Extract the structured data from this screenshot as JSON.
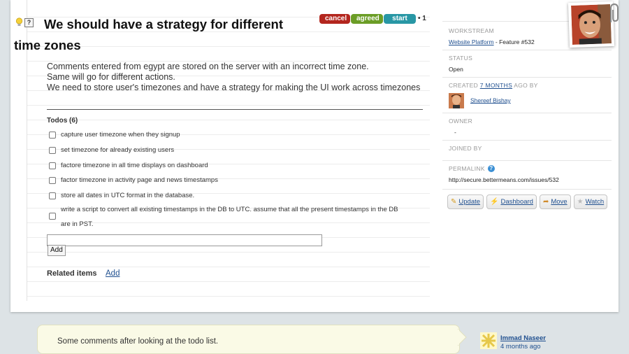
{
  "issue": {
    "title": "We should have a strategy for different time zones",
    "status_buttons": {
      "cancel": "cancel",
      "agreed": "agreed",
      "start": "start"
    },
    "vote_count": "• 1",
    "description": [
      "Comments entered from egypt are stored on the server with an incorrect time zone.",
      "Same will go for different actions.",
      "We need to store user's timezones and have a strategy for making the UI work across timezones"
    ]
  },
  "todos": {
    "header": "Todos (6)",
    "items": [
      "capture user timezone when they signup",
      "set timezone for already existing users",
      "factore timezone in all time displays on dashboard",
      "factor timezone in activity page and news timestamps",
      "store all dates in UTC format in the database.",
      "write a script to convert all existing timestamps in the DB to UTC. assume that all the present timestamps in the DB are in PST."
    ],
    "add_label": "Add",
    "input_value": ""
  },
  "related": {
    "label": "Related items",
    "add_label": "Add"
  },
  "sidebar": {
    "workstream_label": "WORKSTREAM",
    "workstream_link": "Website Platform",
    "workstream_suffix": " - Feature #532",
    "status_label": "STATUS",
    "status_value": "Open",
    "created_prefix": "CREATED ",
    "created_link": "7 MONTHS",
    "created_suffix": " AGO BY",
    "creator_name": "Shereef Bishay",
    "owner_label": "OWNER",
    "owner_value": "-",
    "joined_label": "JOINED BY",
    "permalink_label": "PERMALINK",
    "permalink_value": "http://secure.bettermeans.com/issues/532"
  },
  "actions": {
    "update": "Update",
    "dashboard": "Dashboard",
    "move": "Move",
    "watch": "Watch"
  },
  "comment": {
    "text": "Some comments after looking at the todo list.",
    "author": "Immad Naseer",
    "time": "4 months ago"
  },
  "icons": [
    "bulb-icon",
    "help-icon",
    "pencil-icon",
    "bolt-icon",
    "arrow-icon",
    "star-icon"
  ],
  "colors": {
    "cancel": "#b3261e",
    "agreed": "#6b9d26",
    "start": "#2897a5",
    "link": "#1f4f8f",
    "background": "#dde3e6"
  }
}
